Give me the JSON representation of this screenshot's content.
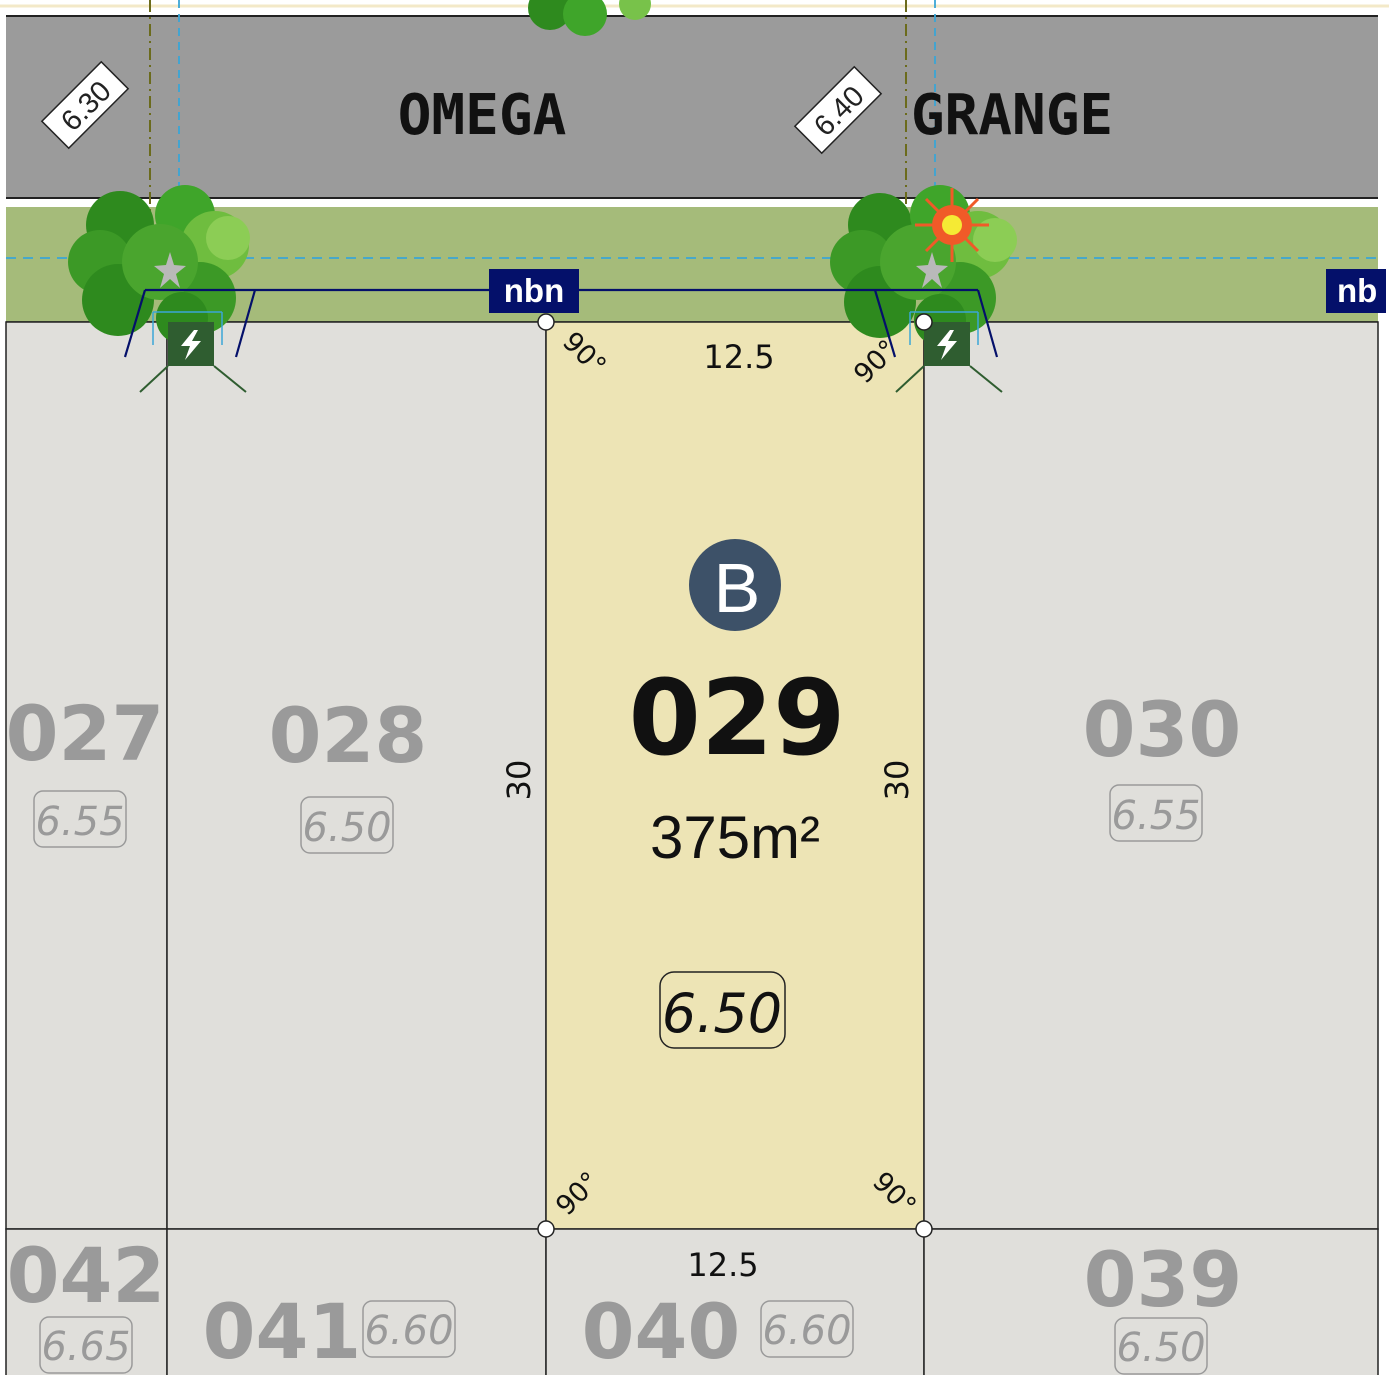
{
  "street": {
    "name_left": "OMEGA",
    "name_right": "GRANGE",
    "level_left": "6.30",
    "level_right": "6.40"
  },
  "service": {
    "nbn_label": "nbn",
    "nbn_label_cut": "nb"
  },
  "subject_lot": {
    "number": "029",
    "area": "375m²",
    "level": "6.50",
    "release_badge": "B",
    "frontage": "12.5",
    "rear": "12.5",
    "side_left": "30",
    "side_right": "30",
    "angle": "90°"
  },
  "lots": [
    {
      "number": "027",
      "level": "6.55"
    },
    {
      "number": "028",
      "level": "6.50"
    },
    {
      "number": "030",
      "level": "6.55"
    },
    {
      "number": "042",
      "level": "6.65"
    },
    {
      "number": "041",
      "level": "6.60"
    },
    {
      "number": "040",
      "level": "6.60"
    },
    {
      "number": "039",
      "level": "6.50"
    }
  ],
  "colors": {
    "road": "#9b9b9b",
    "verge": "#a5bb7a",
    "lot": "#e0dfdb",
    "subject_lot": "#ede4b5",
    "lot_label": "#9a9a9a",
    "badge": "#3d5168",
    "nbn": "#04106a",
    "power_pit": "#2f5d30",
    "streetlight": "#f05a28"
  }
}
